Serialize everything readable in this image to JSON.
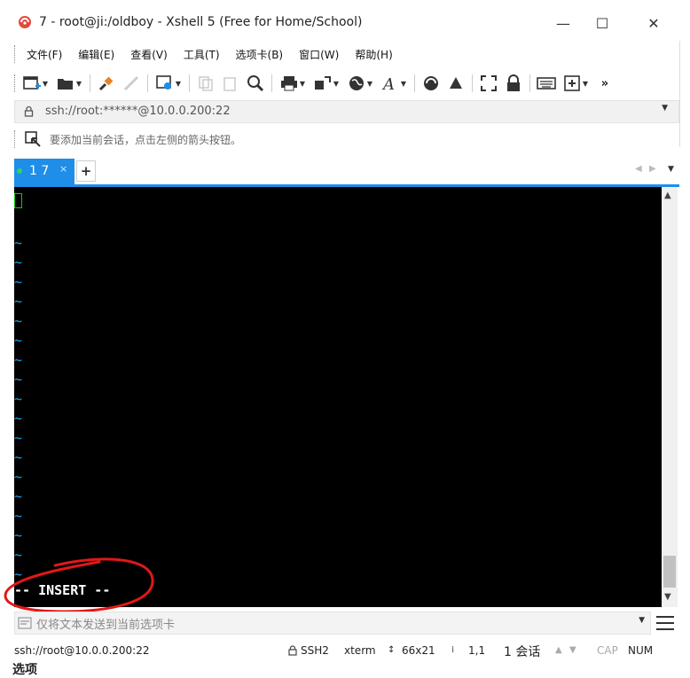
{
  "window": {
    "title": "7 - root@ji:/oldboy - Xshell 5 (Free for Home/School)",
    "minimize_glyph": "—",
    "maximize_glyph": "☐",
    "close_glyph": "✕",
    "app_icon": "xshell-logo-icon"
  },
  "menu": {
    "items": [
      {
        "label": "文件(F)"
      },
      {
        "label": "编辑(E)"
      },
      {
        "label": "查看(V)"
      },
      {
        "label": "工具(T)"
      },
      {
        "label": "选项卡(B)"
      },
      {
        "label": "窗口(W)"
      },
      {
        "label": "帮助(H)"
      }
    ]
  },
  "toolbar": {
    "icons": [
      "new-session-icon",
      "open-folder-icon",
      "connect-icon",
      "disconnect-icon",
      "properties-icon",
      "copy-icon",
      "paste-icon",
      "find-icon",
      "print-icon",
      "transfer-icon",
      "globe-icon",
      "font-icon",
      "xftp-icon",
      "xmanager-icon",
      "fullscreen-icon",
      "lock-icon",
      "keyboard-icon",
      "new-tab-icon",
      "overflow-icon"
    ],
    "overflow_glyph": "»"
  },
  "address": {
    "value": "ssh://root:******@10.0.0.200:22"
  },
  "hint": {
    "text": "要添加当前会话，点击左侧的箭头按钮。"
  },
  "tabs": {
    "active_label": "1 7",
    "close_glyph": "×",
    "add_glyph": "+",
    "prev_glyph": "◀",
    "next_glyph": "▶",
    "menu_glyph": "▼"
  },
  "terminal": {
    "tilde": "~",
    "status_line": "-- INSERT --",
    "colors": {
      "background": "#000000",
      "tilde": "#1ea7e6",
      "cursor": "#00d000"
    }
  },
  "compose": {
    "placeholder": "仅将文本发送到当前选项卡"
  },
  "status": {
    "connection": "ssh://root@10.0.0.200:22",
    "protocol": "SSH2",
    "term": "xterm",
    "size": "66x21",
    "position": "1,1",
    "sessions": "1 会话",
    "cap": "CAP",
    "num": "NUM",
    "overflow_text": "选项"
  },
  "colors": {
    "accent": "#1e8ee8",
    "annotation": "#e01818"
  }
}
